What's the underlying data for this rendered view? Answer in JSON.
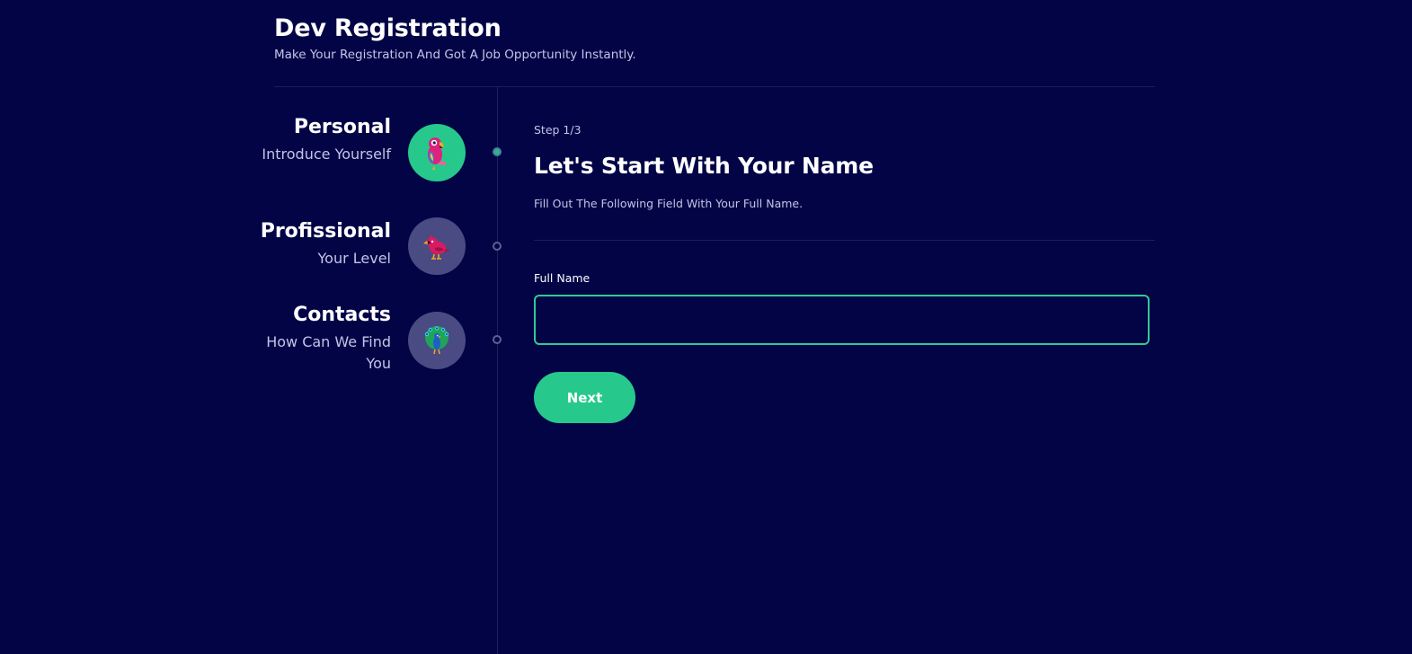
{
  "header": {
    "title": "Dev Registration",
    "subtitle": "Make Your Registration And Got A Job Opportunity Instantly."
  },
  "steps": [
    {
      "title": "Personal",
      "description": "Introduce Yourself",
      "icon": "parrot-icon",
      "active": true
    },
    {
      "title": "Profissional",
      "description": "Your Level",
      "icon": "cardinal-bird-icon",
      "active": false
    },
    {
      "title": "Contacts",
      "description": "How Can We Find You",
      "icon": "peacock-icon",
      "active": false
    }
  ],
  "form": {
    "step_counter": "Step 1/3",
    "title": "Let's Start With Your Name",
    "description": "Fill Out The Following Field With Your Full Name.",
    "field_label": "Full Name",
    "field_value": "",
    "next_label": "Next"
  },
  "colors": {
    "background": "#020446",
    "accent": "#26c98b",
    "inactive_circle": "#4a4b83",
    "muted_text": "#c3c4e6"
  }
}
